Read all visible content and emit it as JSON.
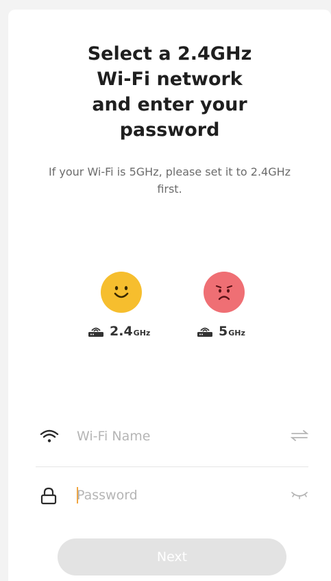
{
  "header": {
    "title_lines": [
      "Select a 2.4GHz",
      "Wi-Fi network",
      "and enter your",
      "password"
    ],
    "subtitle": "If your Wi-Fi is 5GHz, please set it to 2.4GHz first."
  },
  "bands": [
    {
      "number": "2.4",
      "unit": "GHz",
      "face": "happy",
      "color": "#f6be2e"
    },
    {
      "number": "5",
      "unit": "GHz",
      "face": "sad",
      "color": "#ef6f74"
    }
  ],
  "form": {
    "wifi_placeholder": "Wi-Fi Name",
    "wifi_value": "",
    "password_placeholder": "Password",
    "password_value": "",
    "wifi_icon": "wifi-icon",
    "switch_icon": "switch-network-icon",
    "lock_icon": "lock-icon",
    "eye_icon": "eye-closed-icon"
  },
  "actions": {
    "next_label": "Next",
    "next_color": "#e3e3e3"
  }
}
